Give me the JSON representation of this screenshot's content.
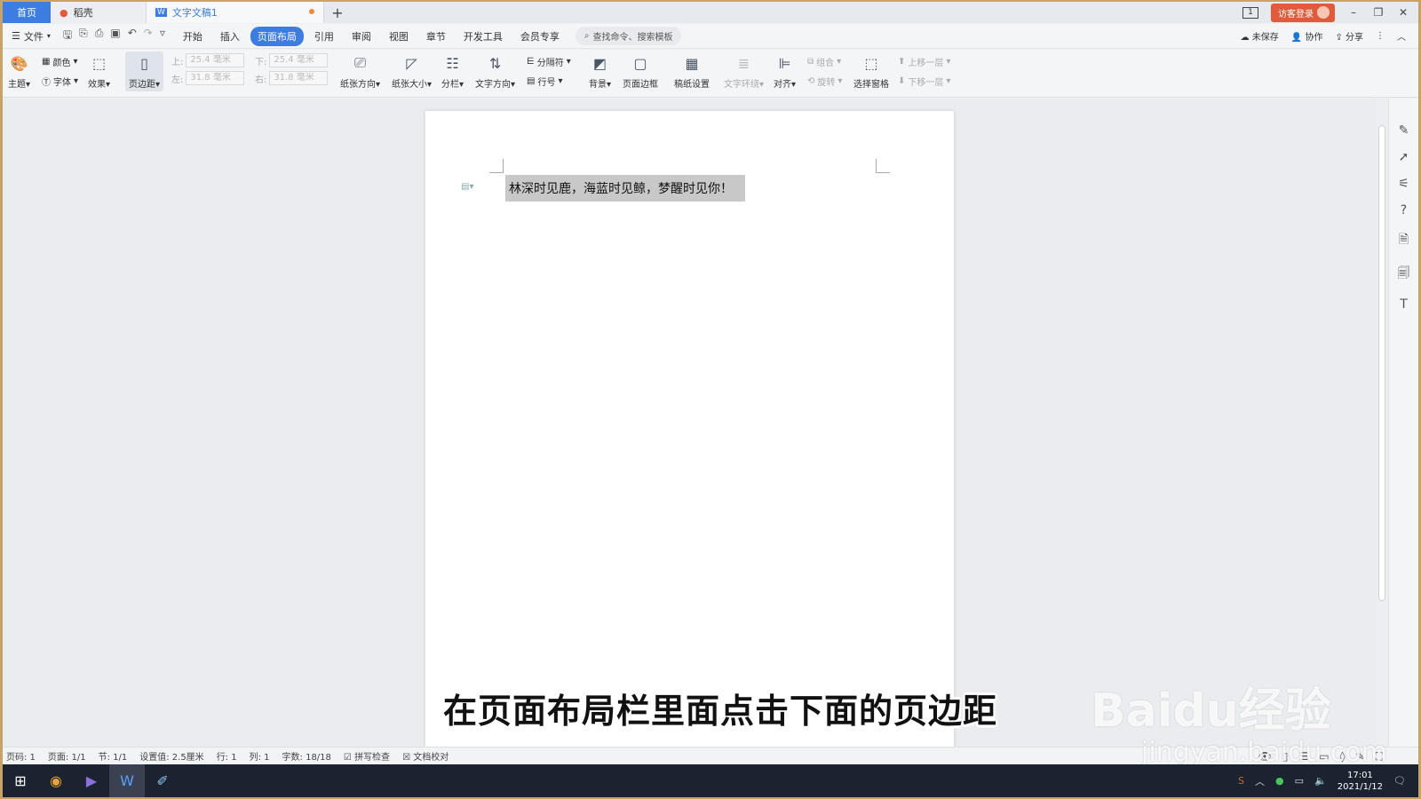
{
  "tabs": {
    "home": "首页",
    "daoke": "稻壳",
    "doc": "文字文稿1",
    "add": "+"
  },
  "titlebar": {
    "page_indicator": "1",
    "login": "访客登录"
  },
  "menu": {
    "file": "文件",
    "tabs": [
      "开始",
      "插入",
      "页面布局",
      "引用",
      "审阅",
      "视图",
      "章节",
      "开发工具",
      "会员专享"
    ],
    "active_tab": "页面布局",
    "search_placeholder": "查找命令、搜索模板",
    "unsaved": "未保存",
    "collab": "协作",
    "share": "分享"
  },
  "ribbon": {
    "theme": "主题",
    "color": "颜色",
    "font": "字体",
    "effect": "效果",
    "margin": "页边距",
    "margin_top_label": "上:",
    "margin_top": "25.4 毫米",
    "margin_bottom_label": "下:",
    "margin_bottom": "25.4 毫米",
    "margin_left_label": "左:",
    "margin_left": "31.8 毫米",
    "margin_right_label": "右:",
    "margin_right": "31.8 毫米",
    "orientation": "纸张方向",
    "paper_size": "纸张大小",
    "columns": "分栏",
    "text_direction": "文字方向",
    "separator": "分隔符",
    "line_number": "行号",
    "background": "背景",
    "page_border": "页面边框",
    "manuscript": "稿纸设置",
    "text_wrap": "文字环绕",
    "align": "对齐",
    "group": "组合",
    "rotate": "旋转",
    "select_pane": "选择窗格",
    "bring_forward": "上移一层",
    "send_backward": "下移一层"
  },
  "document": {
    "line1": "林深时见鹿，海蓝时见鲸，梦醒时见你！"
  },
  "caption": "在页面布局栏里面点击下面的页边距",
  "watermark": {
    "brand": "Baidu经验",
    "url": "jingyan.baidu.com"
  },
  "status": {
    "page_code": "页码: 1",
    "pages": "页面: 1/1",
    "section": "节: 1/1",
    "setting": "设置值: 2.5厘米",
    "row": "行: 1",
    "col": "列: 1",
    "word_count": "字数: 18/18",
    "spell_check": "拼写检查",
    "doc_proof": "文档校对"
  },
  "taskbar": {
    "time": "17:01",
    "date": "2021/1/12"
  },
  "colors": {
    "accent": "#3b7de0",
    "login": "#e05b3c",
    "taskbar": "#1c2330"
  }
}
